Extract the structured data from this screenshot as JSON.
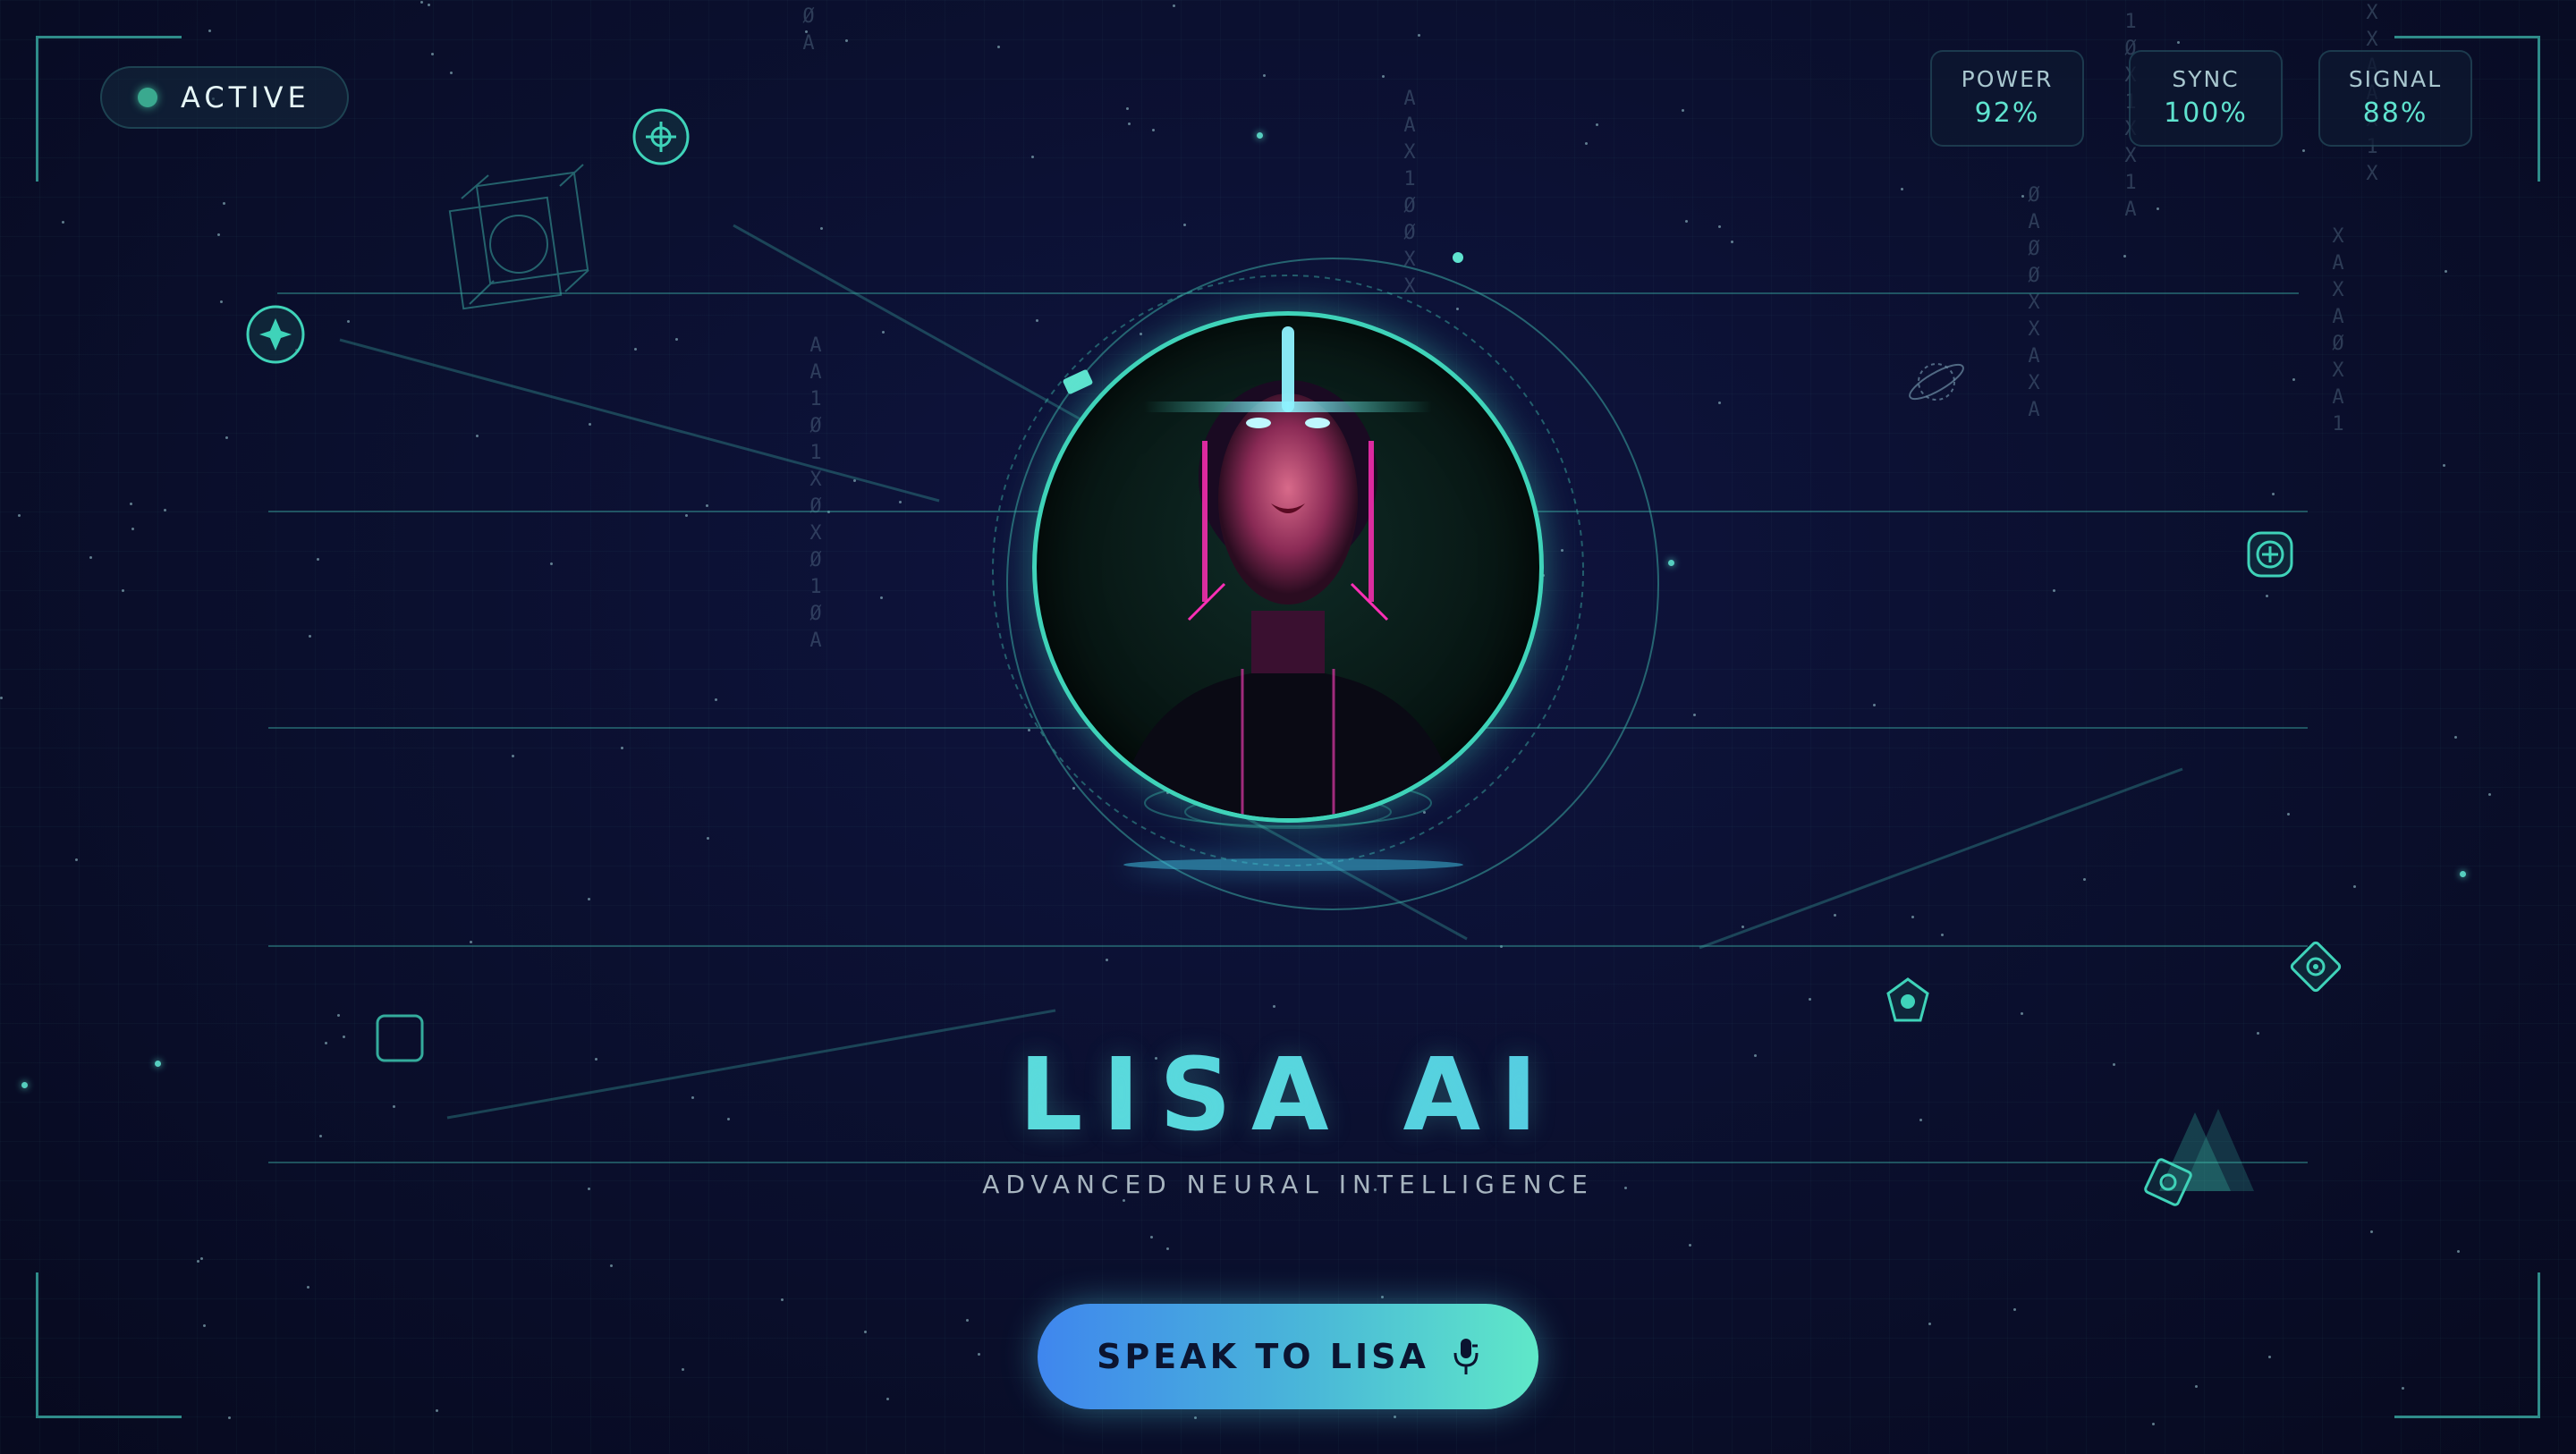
{
  "status": {
    "label": "ACTIVE",
    "dot_color": "#3aa98f"
  },
  "metrics": [
    {
      "label": "POWER",
      "value": "92%"
    },
    {
      "label": "SYNC",
      "value": "100%"
    },
    {
      "label": "SIGNAL",
      "value": "88%"
    }
  ],
  "hero": {
    "title": "LISA AI",
    "subtitle": "ADVANCED NEURAL INTELLIGENCE",
    "avatar": "cyberpunk-android-portrait"
  },
  "cta": {
    "label": "SPEAK TO LISA",
    "icon": "microphone-icon"
  },
  "binary_streams": [
    "ØA",
    "AAX1ØØXX",
    "AA1Ø1XØXØ1ØA",
    "ØAØØXXAXA",
    "1ØX1XX1A",
    "XXAAX1X",
    "XAXAØXA1"
  ],
  "decor_icons": [
    "crosshair-icon",
    "star-icon",
    "cube-wireframe-icon",
    "planet-icon",
    "plus-circle-icon",
    "square-icon",
    "pentagon-chat-icon",
    "diamond-target-icon",
    "triangles-icon"
  ],
  "colors": {
    "accent": "#3fd3b9",
    "accent_blue": "#4a86ee",
    "background": "#0b1030"
  }
}
